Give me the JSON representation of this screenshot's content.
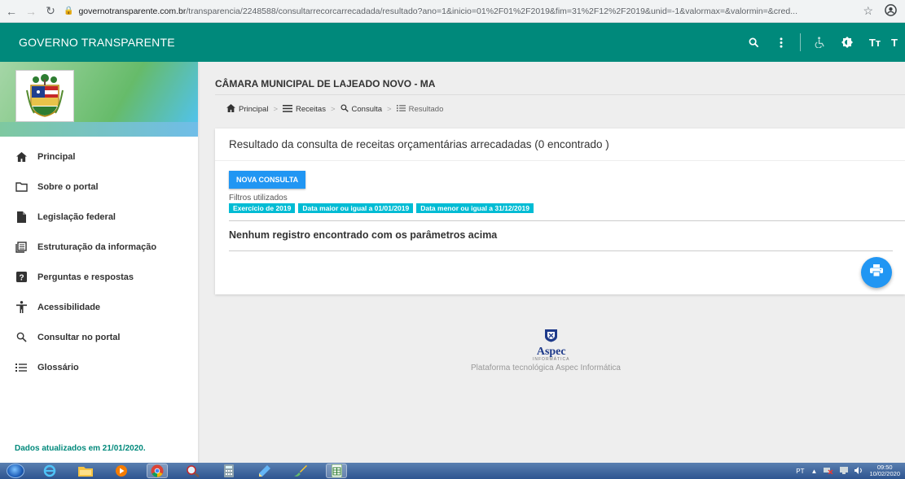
{
  "browser": {
    "url_host": "governotransparente.com.br",
    "url_path": "/transparencia/2248588/consultarrecorcarrecadada/resultado?ano=1&inicio=01%2F01%2F2019&fim=31%2F12%2F2019&unid=-1&valormax=&valormin=&cred..."
  },
  "header": {
    "brand": "GOVERNO TRANSPARENTE",
    "tt_label": "Tт",
    "tt2_label": "T"
  },
  "sidebar": {
    "items": [
      {
        "label": "Principal",
        "icon": "home-icon"
      },
      {
        "label": "Sobre o portal",
        "icon": "folder-icon"
      },
      {
        "label": "Legislação federal",
        "icon": "document-icon"
      },
      {
        "label": "Estruturação da informação",
        "icon": "list-box-icon"
      },
      {
        "label": "Perguntas e respostas",
        "icon": "question-icon"
      },
      {
        "label": "Acessibilidade",
        "icon": "accessibility-icon"
      },
      {
        "label": "Consultar no portal",
        "icon": "search-icon"
      },
      {
        "label": "Glossário",
        "icon": "list-icon"
      }
    ],
    "footer": "Dados atualizados em 21/01/2020."
  },
  "main": {
    "org_title": "CÂMARA MUNICIPAL DE LAJEADO NOVO - MA",
    "breadcrumb": [
      "Principal",
      "Receitas",
      "Consulta",
      "Resultado"
    ],
    "card": {
      "title": "Resultado da consulta de receitas orçamentárias arrecadadas (0 encontrado )",
      "new_query_button": "NOVA CONSULTA",
      "filters_label": "Filtros utilizados",
      "filters": [
        "Exercício de 2019",
        "Data maior ou igual a 01/01/2019",
        "Data menor ou igual a 31/12/2019"
      ],
      "no_records": "Nenhum registro encontrado com os parâmetros acima"
    },
    "footer": {
      "brand": "Aspec",
      "brand_sub": "INFORMÁTICA",
      "text": "Plataforma tecnológica Aspec Informática"
    }
  },
  "taskbar": {
    "language": "PT",
    "time": "09:50",
    "date": "10/02/2020"
  },
  "colors": {
    "header": "#00897b",
    "button": "#2196f3",
    "badge": "#00bcd4"
  }
}
